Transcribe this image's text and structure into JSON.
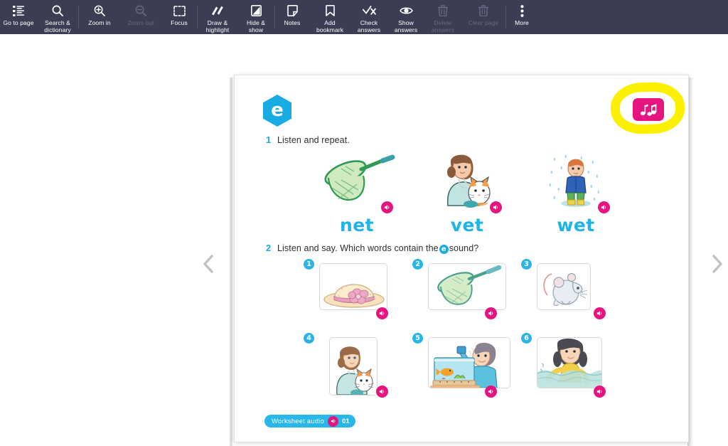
{
  "toolbar": {
    "items": [
      {
        "label": "Go to page",
        "icon": "list-icon",
        "disabled": false
      },
      {
        "label": "Search &\ndictionary",
        "icon": "search-icon",
        "disabled": false
      },
      {
        "label": "Zoom in",
        "icon": "zoom-in-icon",
        "disabled": false
      },
      {
        "label": "Zoom out",
        "icon": "zoom-out-icon",
        "disabled": true
      },
      {
        "label": "Focus",
        "icon": "focus-icon",
        "disabled": false
      },
      {
        "label": "Draw &\nhighlight",
        "icon": "pen-icon",
        "disabled": false
      },
      {
        "label": "Hide &\nshow",
        "icon": "hide-show-icon",
        "disabled": false
      },
      {
        "label": "Notes",
        "icon": "note-icon",
        "disabled": false
      },
      {
        "label": "Add\nbookmark",
        "icon": "bookmark-icon",
        "disabled": false
      },
      {
        "label": "Check\nanswers",
        "icon": "check-icon",
        "disabled": false
      },
      {
        "label": "Show\nanswers",
        "icon": "eye-icon",
        "disabled": false
      },
      {
        "label": "Delete\nanswers",
        "icon": "trash-icon",
        "disabled": true
      },
      {
        "label": "Clear page",
        "icon": "trash-icon",
        "disabled": true
      },
      {
        "label": "More",
        "icon": "more-dots-icon",
        "disabled": false
      }
    ],
    "background_color": "#3b3d52"
  },
  "navigation": {
    "prev_label": "‹",
    "next_label": "›"
  },
  "worksheet": {
    "unit_letter": "e",
    "unit_badge_color": "#19ace3",
    "music_button_color": "#e5147f",
    "highlight_color": "#fbf000",
    "exercise1": {
      "number": "1",
      "instruction": "Listen and repeat.",
      "words": [
        {
          "label": "net",
          "image": "fishing-net-illustration"
        },
        {
          "label": "vet",
          "image": "vet-holding-cat-illustration"
        },
        {
          "label": "wet",
          "image": "boy-in-rain-illustration"
        }
      ]
    },
    "exercise2": {
      "number": "2",
      "instruction_before": "Listen and say. Which words contain the",
      "instruction_letter": "e",
      "instruction_after": "sound?",
      "items": [
        {
          "number": "1",
          "image": "straw-hat-with-flower-illustration"
        },
        {
          "number": "2",
          "image": "fishing-net-illustration"
        },
        {
          "number": "3",
          "image": "mouse-illustration"
        },
        {
          "number": "4",
          "image": "vet-holding-cat-illustration"
        },
        {
          "number": "5",
          "image": "boy-feeding-fish-tank-illustration"
        },
        {
          "number": "6",
          "image": "girl-swimming-illustration"
        }
      ]
    },
    "worksheet_audio": {
      "label": "Worksheet audio",
      "track_number": "01",
      "pill_color": "#29b6e8",
      "speaker_color": "#e5147f"
    }
  }
}
